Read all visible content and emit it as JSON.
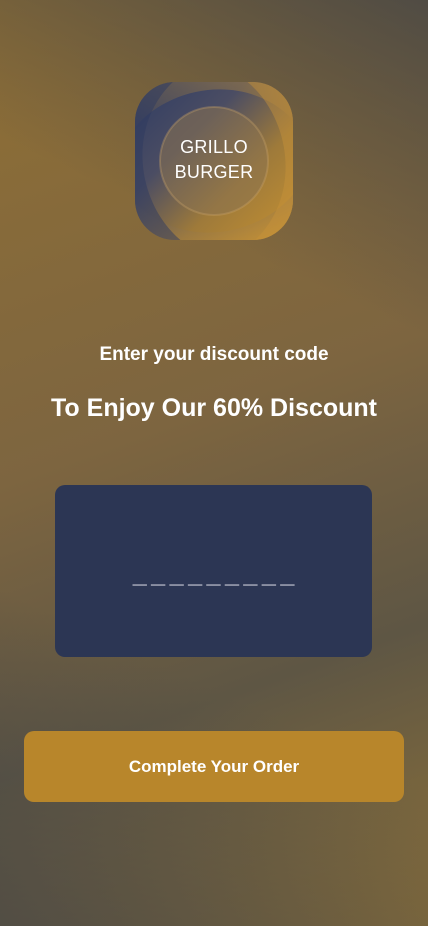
{
  "logo": {
    "line1": "GRILLO",
    "line2": "BURGER"
  },
  "prompt": {
    "subtitle": "Enter your discount code",
    "title": "To Enjoy Our 60% Discount"
  },
  "code_field": {
    "placeholder": "_________",
    "value": ""
  },
  "order_button": {
    "label": "Complete Your Order"
  },
  "colors": {
    "button": "#b8862b",
    "code_box": "#2c3654",
    "logo_blue": "#2f3c63",
    "logo_gold": "#c49032"
  }
}
